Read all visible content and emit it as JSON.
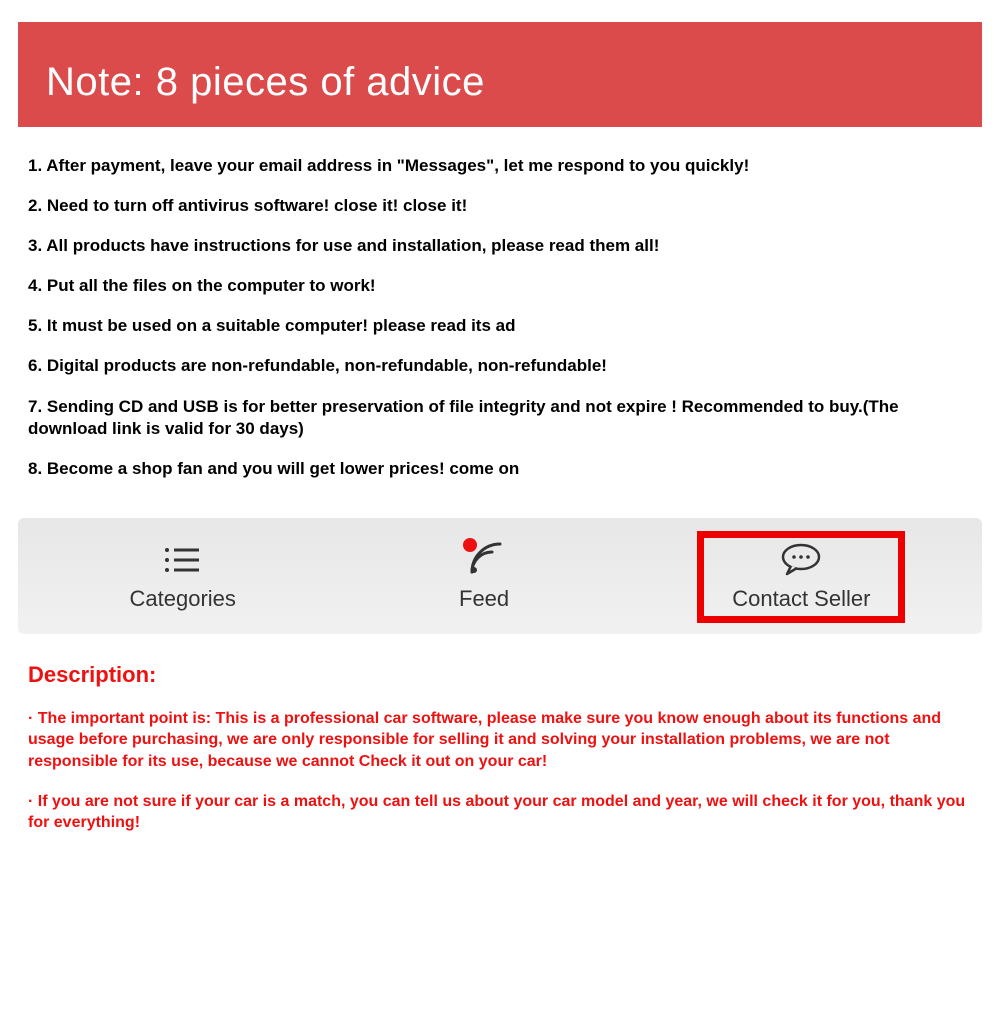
{
  "header": {
    "title": "Note: 8 pieces of advice"
  },
  "advice": [
    "1. After payment, leave your email address in \"Messages\", let me respond to you quickly!",
    "2. Need to turn off antivirus software! close it! close it!",
    "3. All products have instructions for use and installation, please read them all!",
    "4. Put all the files on the computer to work!",
    "5. It must be used on a suitable computer! please read its ad",
    "6. Digital products are non-refundable, non-refundable, non-refundable!",
    "7. Sending CD and USB is for better preservation of file integrity and not expire ! Recommended to buy.(The download link is valid for 30 days)",
    "8. Become a shop fan and you will get lower prices! come on"
  ],
  "nav": {
    "categories": "Categories",
    "feed": "Feed",
    "contact": "Contact Seller"
  },
  "description": {
    "title": "Description:",
    "p1": "· The important point is: This is a professional car software, please make sure you know enough about its functions and usage before purchasing, we are only responsible for selling it and solving your installation problems, we are not responsible for its use, because we cannot Check it out on your car!",
    "p2": "· If you are not sure if your car is a match, you can tell us about your car model and year, we will check it for you, thank you for everything!"
  }
}
